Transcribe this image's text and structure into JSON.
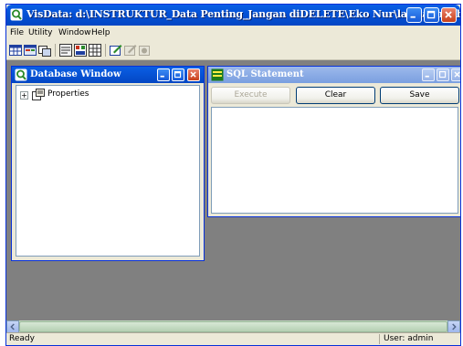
{
  "window": {
    "title": "VisData: d:\\INSTRUKTUR_Data Penting_Jangan diDELETE\\Eko Nur\\latihan.mdb"
  },
  "menu": [
    "File",
    "Utility",
    "Window",
    "Help"
  ],
  "toolbar": {
    "icons": [
      "table-icon",
      "form-icon",
      "link-icon",
      "query-builder-icon",
      "data-form-designer-icon",
      "grid-icon",
      "report-icon",
      "report-disabled-icon",
      "report-disabled-icon-2"
    ]
  },
  "database_window": {
    "title": "Database Window",
    "tree_items": [
      {
        "label": "Properties",
        "expander": "+"
      }
    ]
  },
  "sql_window": {
    "title": "SQL Statement",
    "buttons": {
      "execute": "Execute",
      "clear": "Clear",
      "save": "Save"
    },
    "text": ""
  },
  "status": {
    "left": "Ready",
    "right": "User: admin"
  },
  "colors": {
    "title_active": "#0a5fe5",
    "title_inactive": "#9db9eb",
    "mdi_background": "#808080",
    "face": "#ece9d8"
  }
}
